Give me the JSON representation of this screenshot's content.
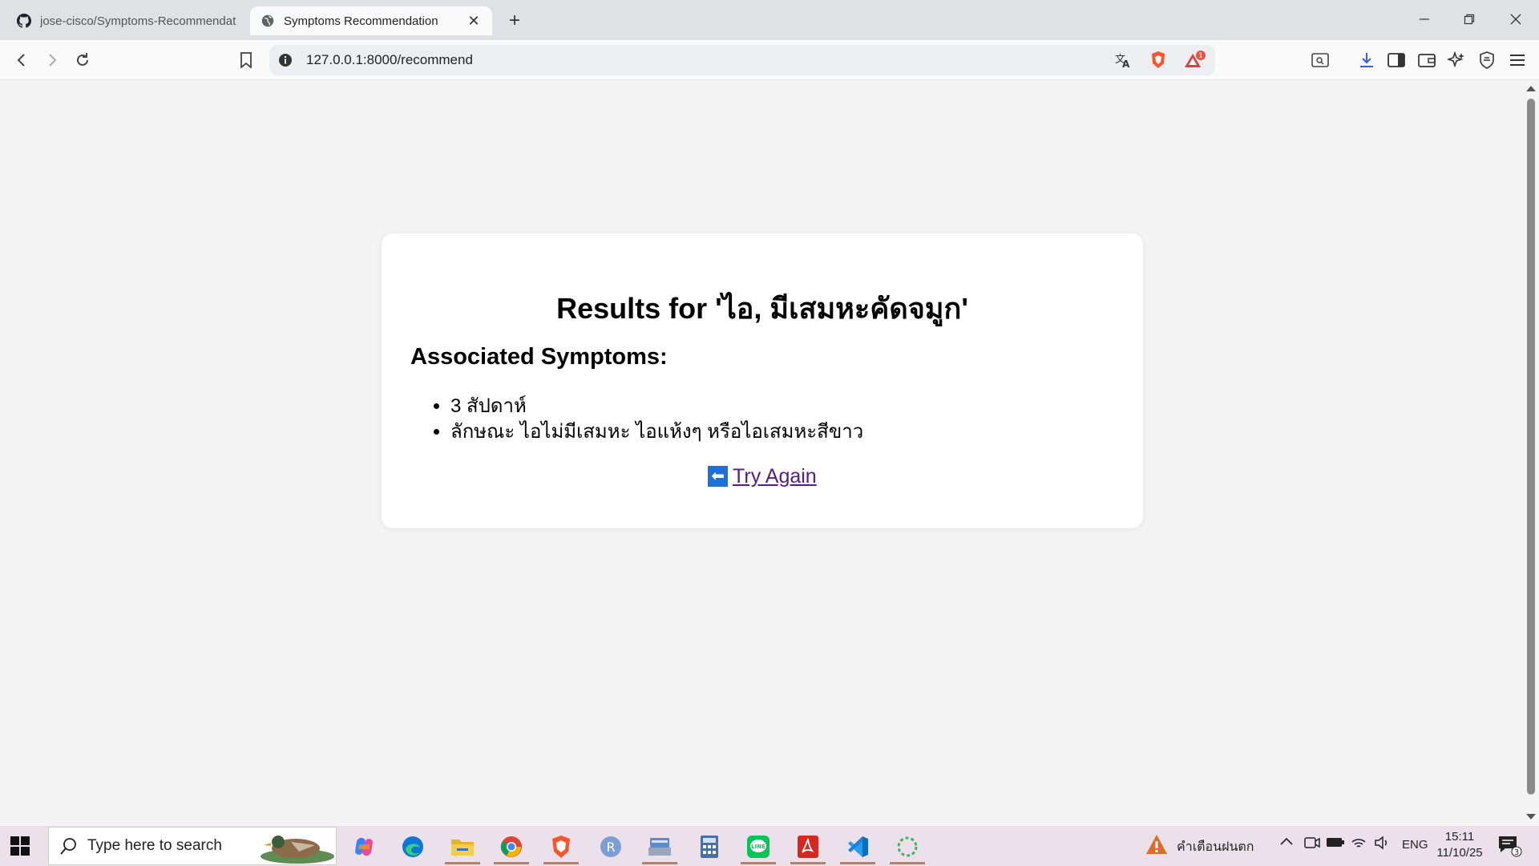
{
  "browser": {
    "tabs": [
      {
        "title": "jose-cisco/Symptoms-Recommendat",
        "icon": "github-icon"
      },
      {
        "title": "Symptoms Recommendation",
        "icon": "globe-icon"
      }
    ],
    "url": "127.0.0.1:8000/recommend",
    "notification_count": "1"
  },
  "page": {
    "heading": "Results for 'ไอ, มีเสมหะคัดจมูก'",
    "subheading": "Associated Symptoms:",
    "symptoms": [
      "3 สัปดาห์",
      "ลักษณะ ไอไม่มีเสมหะ ไอแห้งๆ หรือไอเสมหะสีขาว"
    ],
    "back_arrow": "⬅",
    "try_again_label": "Try Again",
    "link_color": "#551a8b"
  },
  "taskbar": {
    "search_placeholder": "Type here to search",
    "weather_text": "คำเตือนฝนตก",
    "language": "ENG",
    "time": "15:11",
    "date": "11/10/25",
    "notification_count": "3"
  }
}
